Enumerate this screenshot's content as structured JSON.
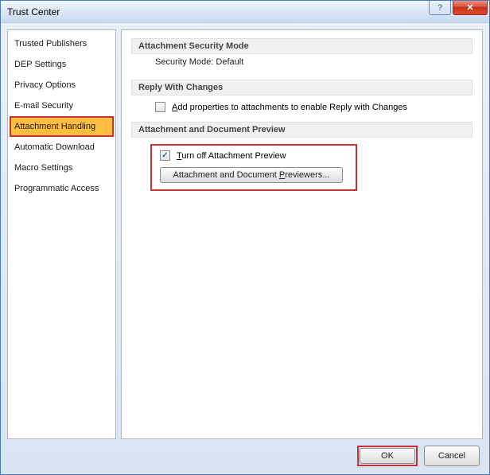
{
  "window": {
    "title": "Trust Center"
  },
  "sidebar": {
    "items": [
      {
        "label": "Trusted Publishers"
      },
      {
        "label": "DEP Settings"
      },
      {
        "label": "Privacy Options"
      },
      {
        "label": "E-mail Security"
      },
      {
        "label": "Attachment Handling"
      },
      {
        "label": "Automatic Download"
      },
      {
        "label": "Macro Settings"
      },
      {
        "label": "Programmatic Access"
      }
    ],
    "selected_index": 4
  },
  "sections": {
    "security_mode": {
      "header": "Attachment Security Mode",
      "body": "Security Mode: Default"
    },
    "reply_changes": {
      "header": "Reply With Changes",
      "checkbox_prefix": "A",
      "checkbox_rest": "dd properties to attachments to enable Reply with Changes",
      "checked": false
    },
    "preview": {
      "header": "Attachment and Document Preview",
      "checkbox_prefix": "T",
      "checkbox_rest": "urn off Attachment Preview",
      "checked": true,
      "button_pre": "Attachment and Document ",
      "button_u": "P",
      "button_post": "reviewers..."
    }
  },
  "footer": {
    "ok": "OK",
    "cancel": "Cancel"
  }
}
